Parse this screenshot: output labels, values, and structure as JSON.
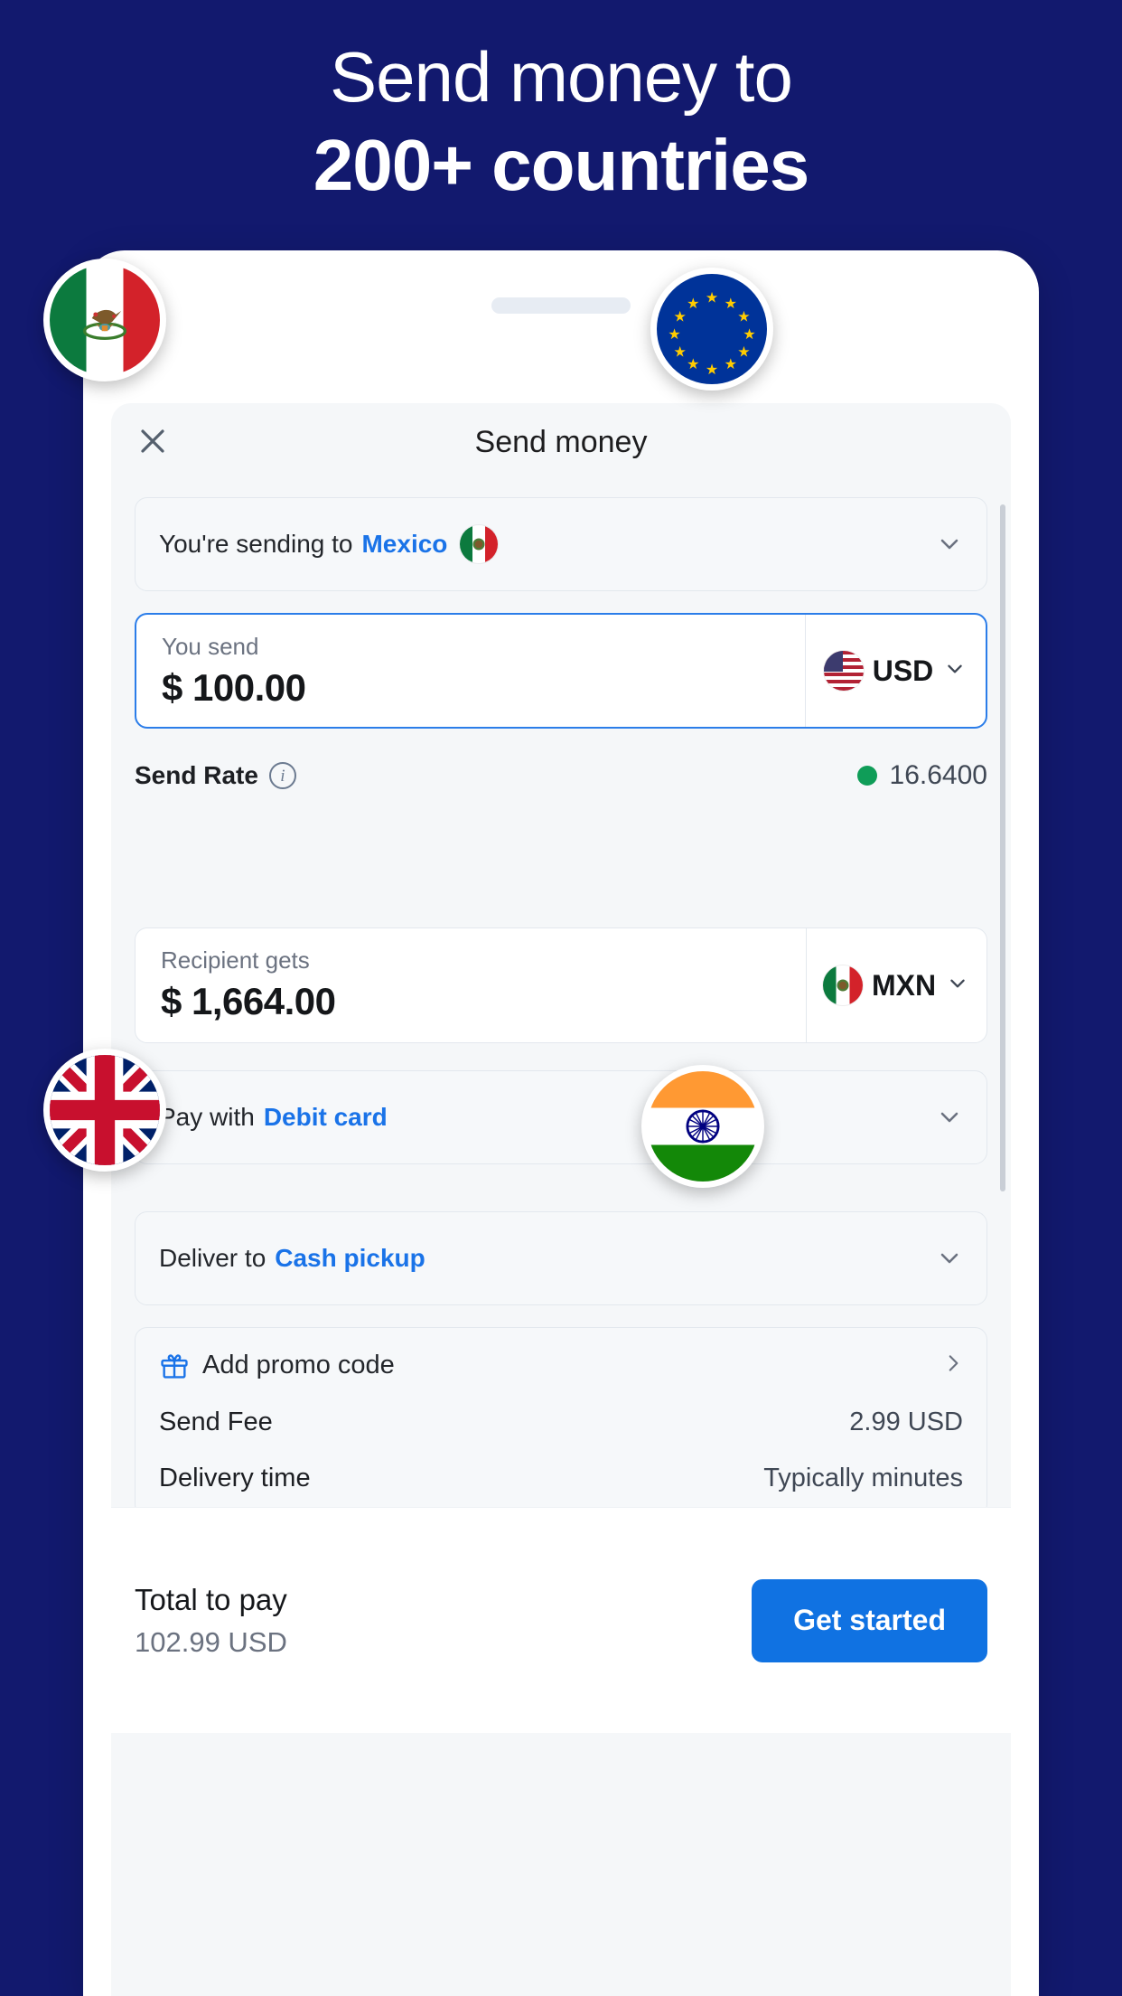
{
  "brand": {
    "navy": "#12196e",
    "accent_blue": "#1a73e8",
    "cta_blue": "#1072e2",
    "green": "#0f9d58"
  },
  "headline": {
    "line1": "Send money to",
    "line2": "200+ countries"
  },
  "sheet": {
    "title": "Send money",
    "close_icon": "close-icon"
  },
  "country_row": {
    "prefix": "You're sending to",
    "country": "Mexico",
    "flag": "mexico-flag-icon",
    "chevron": "chevron-down-icon"
  },
  "send": {
    "label": "You send",
    "value": "$ 100.00",
    "currency": "USD",
    "flag": "usa-flag-icon",
    "chevron": "chevron-down-icon"
  },
  "rate": {
    "label": "Send Rate",
    "info_icon": "info-icon",
    "status_dot": "green-status-dot",
    "value": "16.6400"
  },
  "receive": {
    "label": "Recipient gets",
    "value": "$ 1,664.00",
    "currency": "MXN",
    "flag": "mexico-flag-icon",
    "chevron": "chevron-down-icon"
  },
  "pay_row": {
    "prefix": "Pay with",
    "method": "Debit card",
    "chevron": "chevron-down-icon"
  },
  "deliver_row": {
    "prefix": "Deliver to",
    "method": "Cash pickup",
    "chevron": "chevron-down-icon"
  },
  "promo": {
    "icon": "gift-icon",
    "label": "Add promo code",
    "arrow": "chevron-right-icon"
  },
  "fees": {
    "send_fee_label": "Send Fee",
    "send_fee_value": "2.99 USD",
    "delivery_label": "Delivery time",
    "delivery_value": "Typically minutes"
  },
  "footer": {
    "total_label": "Total to pay",
    "total_value": "102.99 USD",
    "cta_label": "Get started"
  },
  "badges": [
    {
      "name": "mexico-flag-badge"
    },
    {
      "name": "european-union-flag-badge"
    },
    {
      "name": "united-kingdom-flag-badge"
    },
    {
      "name": "india-flag-badge"
    }
  ]
}
